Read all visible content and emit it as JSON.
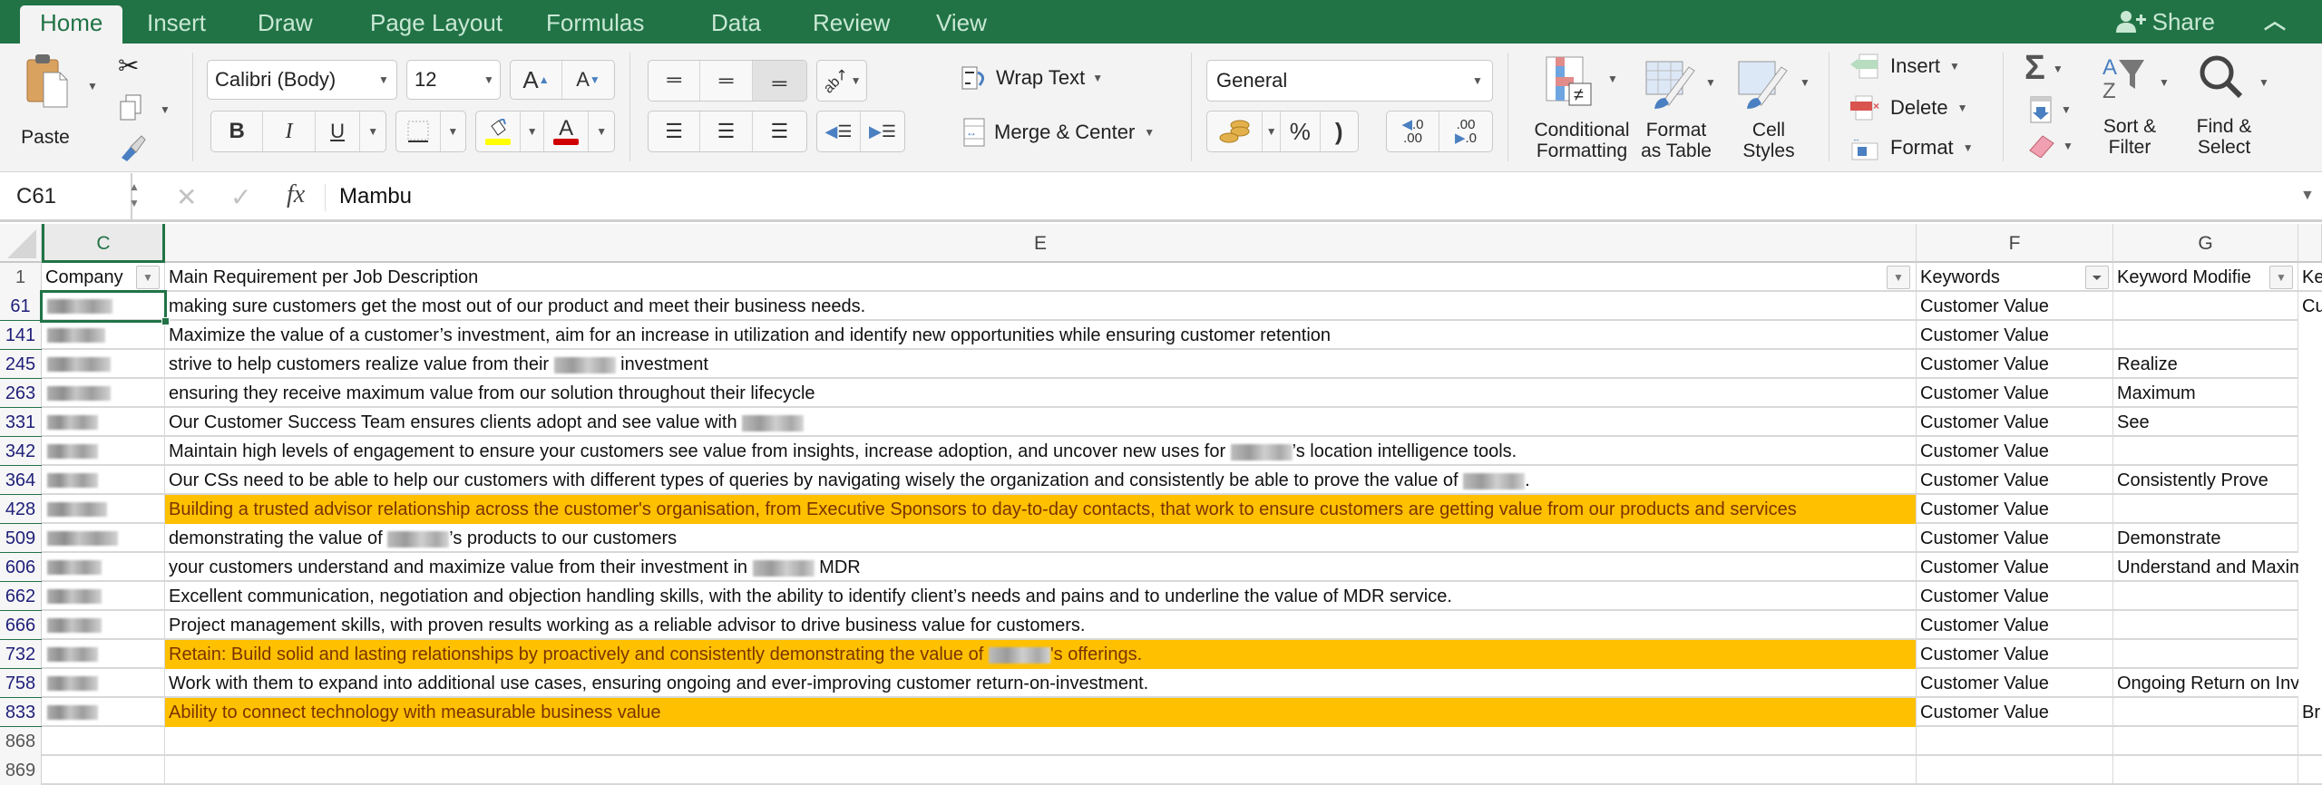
{
  "tabs": [
    "Home",
    "Insert",
    "Draw",
    "Page Layout",
    "Formulas",
    "Data",
    "Review",
    "View"
  ],
  "active_tab": "Home",
  "share_label": "Share",
  "ribbon": {
    "paste_label": "Paste",
    "font_name": "Calibri (Body)",
    "font_size": "12",
    "bold": "B",
    "italic": "I",
    "underline": "U",
    "wrap_text": "Wrap Text",
    "merge_center": "Merge & Center",
    "number_format": "General",
    "percent": "%",
    "comma": ")",
    "inc_decimal_top": ".0",
    "inc_decimal_bottom": ".00",
    "dec_decimal_top": ".00",
    "dec_decimal_bottom": ".0",
    "conditional_formatting": [
      "Conditional",
      "Formatting"
    ],
    "format_as_table": [
      "Format",
      "as Table"
    ],
    "cell_styles": [
      "Cell",
      "Styles"
    ],
    "insert": "Insert",
    "delete": "Delete",
    "format": "Format",
    "sort_filter": [
      "Sort &",
      "Filter"
    ],
    "find_select": [
      "Find &",
      "Select"
    ],
    "fill_color": "#ffff00",
    "font_color": "#d00000"
  },
  "formula_bar": {
    "name_box": "C61",
    "fx": "fx",
    "content": "Mambu"
  },
  "columns": [
    {
      "letter": "C",
      "selected": true
    },
    {
      "letter": "E"
    },
    {
      "letter": "F"
    },
    {
      "letter": "G"
    }
  ],
  "header_row": {
    "num": "1",
    "company": "Company",
    "requirement": "Main Requirement per Job Description",
    "keywords": "Keywords",
    "keyword_modifier": "Keyword Modifie",
    "next_col": "Ke"
  },
  "highlight_color": "#ffc000",
  "rows": [
    {
      "num": "61",
      "company_w": 72,
      "parts": [
        "making sure customers get the most out of our product and meet their business needs."
      ],
      "keywords": "Customer Value",
      "modifier": "",
      "next": "Cu",
      "highlight": false
    },
    {
      "num": "141",
      "company_w": 64,
      "parts": [
        "Maximize the value of a customer’s investment, aim for an increase in utilization and identify new opportunities while ensuring customer retention"
      ],
      "keywords": "Customer Value",
      "modifier": "",
      "next": "",
      "highlight": false
    },
    {
      "num": "245",
      "company_w": 70,
      "parts": [
        "strive to help customers realize value from their ",
        "[redacted]",
        " investment"
      ],
      "keywords": "Customer Value",
      "modifier": "Realize",
      "next": "",
      "highlight": false
    },
    {
      "num": "263",
      "company_w": 70,
      "parts": [
        "ensuring they receive maximum value from our solution throughout their lifecycle"
      ],
      "keywords": "Customer Value",
      "modifier": "Maximum",
      "next": "",
      "highlight": false
    },
    {
      "num": "331",
      "company_w": 56,
      "parts": [
        "Our Customer Success Team ensures clients adopt and see value with ",
        "[redacted]"
      ],
      "keywords": "Customer Value",
      "modifier": "See",
      "next": "",
      "highlight": false
    },
    {
      "num": "342",
      "company_w": 56,
      "parts": [
        "Maintain high levels of engagement to ensure your customers see value from insights, increase adoption, and uncover new uses for ",
        "[redacted]",
        "’s location intelligence tools."
      ],
      "keywords": "Customer Value",
      "modifier": "",
      "next": "",
      "highlight": false
    },
    {
      "num": "364",
      "company_w": 56,
      "parts": [
        "Our CSs need to be able to help our customers with different types of queries by navigating wisely the organization and consistently be able to prove the value of ",
        "[redacted]",
        "."
      ],
      "keywords": "Customer Value",
      "modifier": "Consistently Prove",
      "next": "",
      "highlight": false
    },
    {
      "num": "428",
      "company_w": 66,
      "parts": [
        "Building a trusted advisor relationship across the customer's organisation, from Executive Sponsors to day-to-day contacts, that work to ensure customers are getting value from our products and services"
      ],
      "keywords": "Customer Value",
      "modifier": "",
      "next": "",
      "highlight": true
    },
    {
      "num": "509",
      "company_w": 78,
      "parts": [
        "demonstrating the value of ",
        "[redacted]",
        "’s products to our customers"
      ],
      "keywords": "Customer Value",
      "modifier": "Demonstrate",
      "next": "",
      "highlight": false
    },
    {
      "num": "606",
      "company_w": 60,
      "parts": [
        "your customers understand and maximize value from their investment in ",
        "[redacted]",
        " MDR"
      ],
      "keywords": "Customer Value",
      "modifier": "Understand and Maximize",
      "next": "",
      "highlight": false
    },
    {
      "num": "662",
      "company_w": 60,
      "parts": [
        "Excellent communication, negotiation and objection handling skills, with the ability to identify client’s needs and pains and to underline the value of MDR service."
      ],
      "keywords": "Customer Value",
      "modifier": "",
      "next": "",
      "highlight": false
    },
    {
      "num": "666",
      "company_w": 60,
      "parts": [
        "Project management skills, with proven results working as a reliable advisor to drive business value for customers."
      ],
      "keywords": "Customer Value",
      "modifier": "",
      "next": "",
      "highlight": false
    },
    {
      "num": "732",
      "company_w": 56,
      "parts": [
        "Retain: Build solid and lasting relationships by proactively and consistently demonstrating the value of ",
        "[redacted]",
        "'s offerings."
      ],
      "keywords": "Customer Value",
      "modifier": "",
      "next": "",
      "highlight": true
    },
    {
      "num": "758",
      "company_w": 56,
      "parts": [
        "Work with them to expand into additional use cases, ensuring ongoing and ever-improving customer return-on-investment."
      ],
      "keywords": "Customer Value",
      "modifier": "Ongoing Return on Investment",
      "next": "",
      "highlight": false
    },
    {
      "num": "833",
      "company_w": 56,
      "parts": [
        "Ability to connect technology with measurable business value"
      ],
      "keywords": "Customer Value",
      "modifier": "",
      "next": "Br",
      "highlight": true
    }
  ],
  "empty_rows": [
    "868",
    "869"
  ]
}
